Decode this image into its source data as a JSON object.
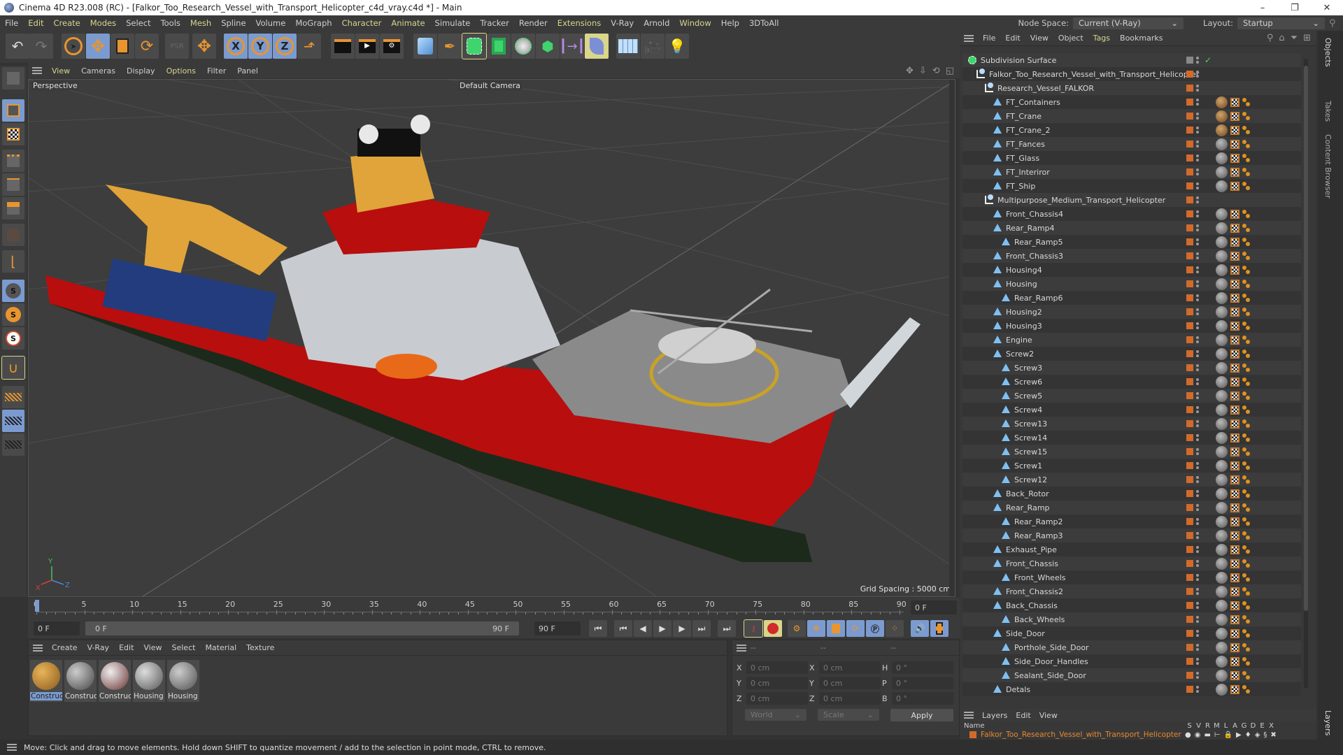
{
  "window": {
    "title": "Cinema 4D R23.008 (RC) - [Falkor_Too_Research_Vessel_with_Transport_Helicopter_c4d_vray.c4d *] - Main",
    "minimize": "–",
    "maximize": "❐",
    "close": "✕"
  },
  "menubar": {
    "items": [
      "File",
      "Edit",
      "Create",
      "Modes",
      "Select",
      "Tools",
      "Mesh",
      "Spline",
      "Volume",
      "MoGraph",
      "Character",
      "Animate",
      "Simulate",
      "Tracker",
      "Render",
      "Extensions",
      "V-Ray",
      "Arnold",
      "Window",
      "Help",
      "3DToAll"
    ],
    "node_space_label": "Node Space:",
    "node_space_value": "Current (V-Ray)",
    "layout_label": "Layout:",
    "layout_value": "Startup"
  },
  "toolbar": {
    "axis_x": "X",
    "axis_y": "Y",
    "axis_z": "Z"
  },
  "viewport": {
    "menu": [
      "View",
      "Cameras",
      "Display",
      "Options",
      "Filter",
      "Panel"
    ],
    "view_name": "Perspective",
    "camera": "Default Camera",
    "grid_spacing": "Grid Spacing : 5000 cm",
    "axis_labels": {
      "x": "X",
      "y": "Y",
      "z": "Z"
    }
  },
  "timeline": {
    "ticks": [
      "0",
      "5",
      "10",
      "15",
      "20",
      "25",
      "30",
      "35",
      "40",
      "45",
      "50",
      "55",
      "60",
      "65",
      "70",
      "75",
      "80",
      "85",
      "90"
    ],
    "current_frame": "0 F",
    "start_field": "0 F",
    "range_start": "0 F",
    "range_end": "90 F",
    "end_field": "90 F"
  },
  "materials": {
    "menu": [
      "Create",
      "V-Ray",
      "Edit",
      "View",
      "Select",
      "Material",
      "Texture"
    ],
    "items": [
      {
        "label": "Construc",
        "color": "#c9922e"
      },
      {
        "label": "Construc",
        "color": "#8a8a8a"
      },
      {
        "label": "Construc",
        "color": "#b9b0a8"
      },
      {
        "label": "Housing",
        "color": "#9a9a9a"
      },
      {
        "label": "Housing",
        "color": "#8c8c8c"
      }
    ]
  },
  "coordinates": {
    "headers": [
      "--",
      "--",
      "--"
    ],
    "rows": [
      {
        "l1": "X",
        "v1": "0 cm",
        "l2": "X",
        "v2": "0 cm",
        "l3": "H",
        "v3": "0 °"
      },
      {
        "l1": "Y",
        "v1": "0 cm",
        "l2": "Y",
        "v2": "0 cm",
        "l3": "P",
        "v3": "0 °"
      },
      {
        "l1": "Z",
        "v1": "0 cm",
        "l2": "Z",
        "v2": "0 cm",
        "l3": "B",
        "v3": "0 °"
      }
    ],
    "space": "World",
    "mode": "Scale",
    "apply": "Apply"
  },
  "objects": {
    "menu": [
      "File",
      "Edit",
      "View",
      "Object",
      "Tags",
      "Bookmarks"
    ],
    "rows": [
      {
        "name": "Subdivision Surface",
        "depth": 0,
        "type": "sds",
        "tags": false
      },
      {
        "name": "Falkor_Too_Research_Vessel_with_Transport_Helicopter",
        "depth": 1,
        "type": "null",
        "tags": false
      },
      {
        "name": "Research_Vessel_FALKOR",
        "depth": 2,
        "type": "null",
        "tags": false
      },
      {
        "name": "FT_Containers",
        "depth": 3,
        "type": "poly",
        "tags": true,
        "mat": "orange"
      },
      {
        "name": "FT_Crane",
        "depth": 3,
        "type": "poly",
        "tags": true,
        "mat": "orange"
      },
      {
        "name": "FT_Crane_2",
        "depth": 3,
        "type": "poly",
        "tags": true,
        "mat": "orange"
      },
      {
        "name": "FT_Fances",
        "depth": 3,
        "type": "poly",
        "tags": true,
        "mat": "grey"
      },
      {
        "name": "FT_Glass",
        "depth": 3,
        "type": "poly",
        "tags": true,
        "mat": "grey"
      },
      {
        "name": "FT_Interiror",
        "depth": 3,
        "type": "poly",
        "tags": true,
        "mat": "grey"
      },
      {
        "name": "FT_Ship",
        "depth": 3,
        "type": "poly",
        "tags": true,
        "mat": "grey"
      },
      {
        "name": "Multipurpose_Medium_Transport_Helicopter",
        "depth": 2,
        "type": "null",
        "tags": false
      },
      {
        "name": "Front_Chassis4",
        "depth": 3,
        "type": "poly",
        "tags": true,
        "mat": "grey"
      },
      {
        "name": "Rear_Ramp4",
        "depth": 3,
        "type": "poly",
        "tags": true,
        "mat": "grey"
      },
      {
        "name": "Rear_Ramp5",
        "depth": 4,
        "type": "poly",
        "tags": true,
        "mat": "grey"
      },
      {
        "name": "Front_Chassis3",
        "depth": 3,
        "type": "poly",
        "tags": true,
        "mat": "grey"
      },
      {
        "name": "Housing4",
        "depth": 3,
        "type": "poly",
        "tags": true,
        "mat": "grey"
      },
      {
        "name": "Housing",
        "depth": 3,
        "type": "poly",
        "tags": true,
        "mat": "grey"
      },
      {
        "name": "Rear_Ramp6",
        "depth": 4,
        "type": "poly",
        "tags": true,
        "mat": "grey"
      },
      {
        "name": "Housing2",
        "depth": 3,
        "type": "poly",
        "tags": true,
        "mat": "grey"
      },
      {
        "name": "Housing3",
        "depth": 3,
        "type": "poly",
        "tags": true,
        "mat": "grey"
      },
      {
        "name": "Engine",
        "depth": 3,
        "type": "poly",
        "tags": true,
        "mat": "grey"
      },
      {
        "name": "Screw2",
        "depth": 3,
        "type": "poly",
        "tags": true,
        "mat": "grey"
      },
      {
        "name": "Screw3",
        "depth": 4,
        "type": "poly",
        "tags": true,
        "mat": "grey"
      },
      {
        "name": "Screw6",
        "depth": 4,
        "type": "poly",
        "tags": true,
        "mat": "grey"
      },
      {
        "name": "Screw5",
        "depth": 4,
        "type": "poly",
        "tags": true,
        "mat": "grey"
      },
      {
        "name": "Screw4",
        "depth": 4,
        "type": "poly",
        "tags": true,
        "mat": "grey"
      },
      {
        "name": "Screw13",
        "depth": 4,
        "type": "poly",
        "tags": true,
        "mat": "grey"
      },
      {
        "name": "Screw14",
        "depth": 4,
        "type": "poly",
        "tags": true,
        "mat": "grey"
      },
      {
        "name": "Screw15",
        "depth": 4,
        "type": "poly",
        "tags": true,
        "mat": "grey"
      },
      {
        "name": "Screw1",
        "depth": 4,
        "type": "poly",
        "tags": true,
        "mat": "grey"
      },
      {
        "name": "Screw12",
        "depth": 4,
        "type": "poly",
        "tags": true,
        "mat": "grey"
      },
      {
        "name": "Back_Rotor",
        "depth": 3,
        "type": "poly",
        "tags": true,
        "mat": "grey"
      },
      {
        "name": "Rear_Ramp",
        "depth": 3,
        "type": "poly",
        "tags": true,
        "mat": "grey"
      },
      {
        "name": "Rear_Ramp2",
        "depth": 4,
        "type": "poly",
        "tags": true,
        "mat": "grey"
      },
      {
        "name": "Rear_Ramp3",
        "depth": 4,
        "type": "poly",
        "tags": true,
        "mat": "grey"
      },
      {
        "name": "Exhaust_Pipe",
        "depth": 3,
        "type": "poly",
        "tags": true,
        "mat": "grey"
      },
      {
        "name": "Front_Chassis",
        "depth": 3,
        "type": "poly",
        "tags": true,
        "mat": "grey"
      },
      {
        "name": "Front_Wheels",
        "depth": 4,
        "type": "poly",
        "tags": true,
        "mat": "grey"
      },
      {
        "name": "Front_Chassis2",
        "depth": 3,
        "type": "poly",
        "tags": true,
        "mat": "grey"
      },
      {
        "name": "Back_Chassis",
        "depth": 3,
        "type": "poly",
        "tags": true,
        "mat": "grey"
      },
      {
        "name": "Back_Wheels",
        "depth": 4,
        "type": "poly",
        "tags": true,
        "mat": "grey"
      },
      {
        "name": "Side_Door",
        "depth": 3,
        "type": "poly",
        "tags": true,
        "mat": "grey"
      },
      {
        "name": "Porthole_Side_Door",
        "depth": 4,
        "type": "poly",
        "tags": true,
        "mat": "grey"
      },
      {
        "name": "Side_Door_Handles",
        "depth": 4,
        "type": "poly",
        "tags": true,
        "mat": "grey"
      },
      {
        "name": "Sealant_Side_Door",
        "depth": 4,
        "type": "poly",
        "tags": true,
        "mat": "grey"
      },
      {
        "name": "Detals",
        "depth": 3,
        "type": "poly",
        "tags": true,
        "mat": "grey"
      }
    ]
  },
  "side_tabs": [
    "Objects",
    "Takes",
    "Content Browser",
    "Layers"
  ],
  "layers": {
    "menu": [
      "Layers",
      "Edit",
      "View"
    ],
    "name_header": "Name",
    "columns": [
      "S",
      "V",
      "R",
      "M",
      "L",
      "A",
      "G",
      "D",
      "E",
      "X"
    ],
    "layer_name": "Falkor_Too_Research_Vessel_with_Transport_Helicopter",
    "layer_color": "#d26a2a"
  },
  "status": {
    "text": "Move: Click and drag to move elements. Hold down SHIFT to quantize movement / add to the selection in point mode, CTRL to remove."
  },
  "colors": {
    "accent_blue": "#7b9bd0",
    "accent_yellow": "#d7d58f",
    "object_orange": "#d26a2a"
  }
}
